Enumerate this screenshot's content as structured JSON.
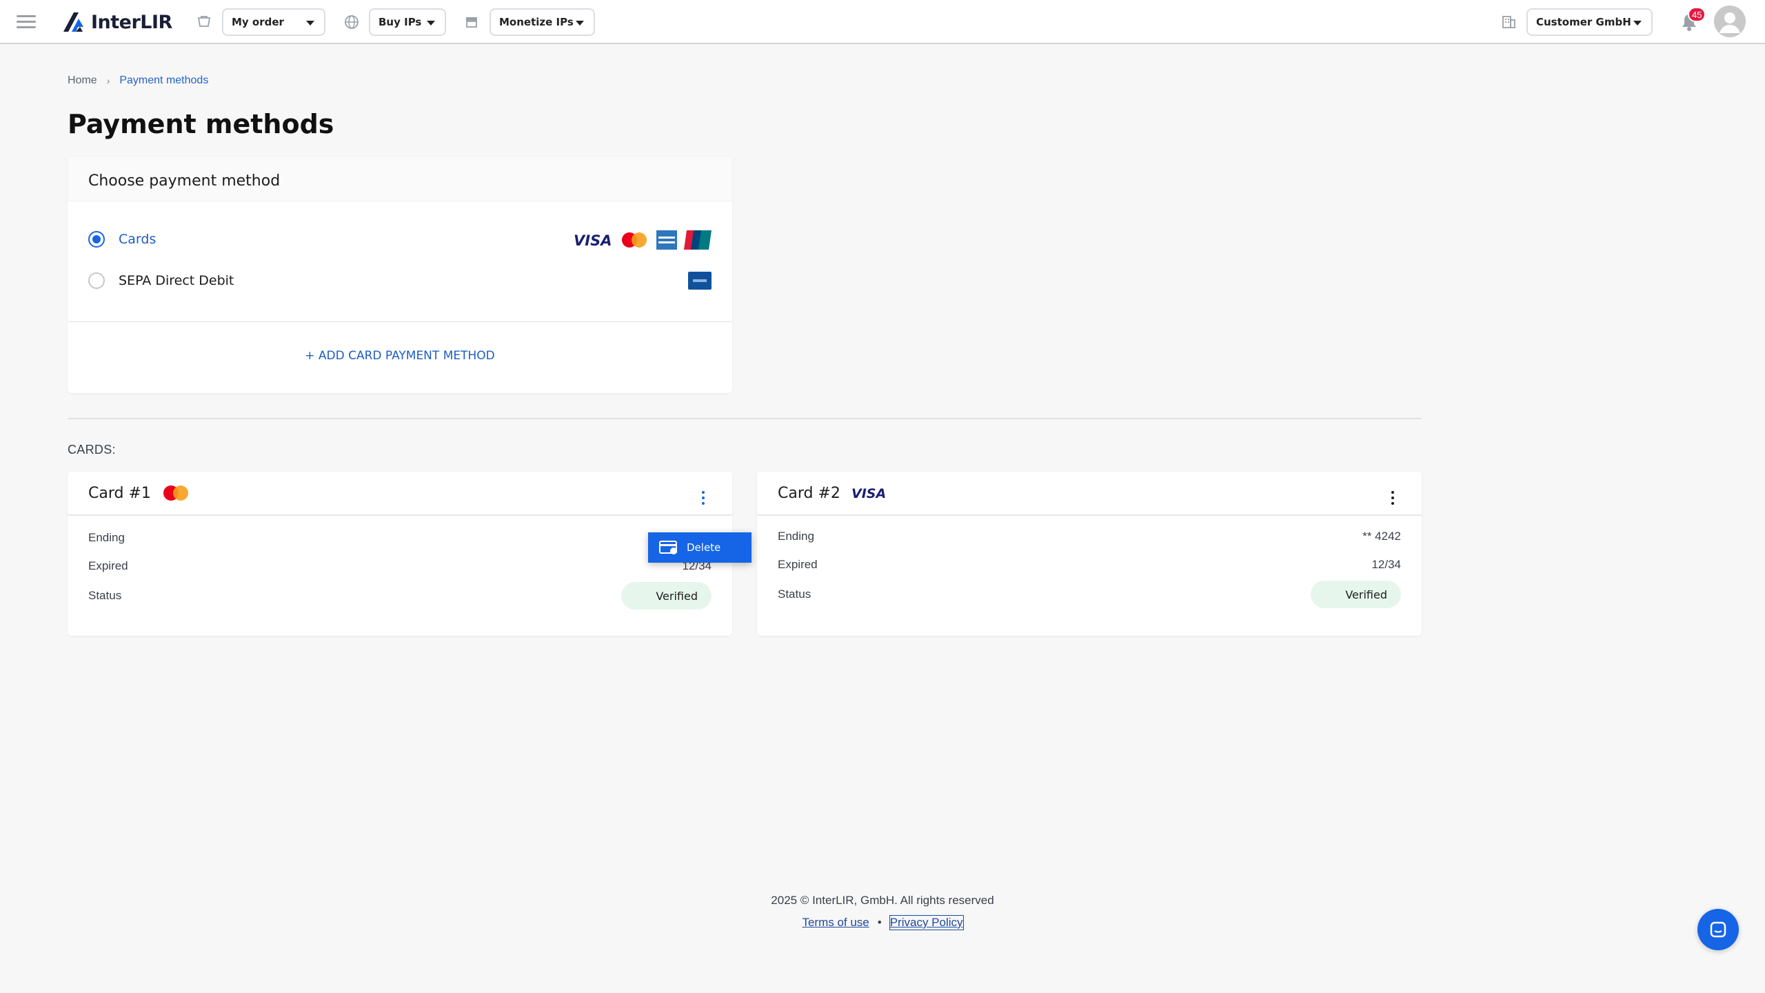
{
  "colors": {
    "accent": "#1565e6",
    "link": "#1e5cc4",
    "badge": "#e5193f",
    "verified_bg": "#e6f6ec"
  },
  "header": {
    "logo_text": "InterLIR",
    "my_order": "My order",
    "buy_ips": "Buy IPs",
    "monetize_ips": "Monetize IPs",
    "company": "Customer GmbH",
    "notification_count": "45"
  },
  "breadcrumb": {
    "home": "Home",
    "current": "Payment methods"
  },
  "page_title": "Payment methods",
  "payment": {
    "heading": "Choose payment method",
    "options": [
      {
        "label": "Cards",
        "selected": true,
        "brands": [
          "visa-icon",
          "mastercard-icon",
          "amex-icon",
          "unionpay-icon"
        ]
      },
      {
        "label": "SEPA Direct Debit",
        "selected": false,
        "brands": [
          "sepa-icon"
        ]
      }
    ],
    "add_button": "+ ADD CARD PAYMENT METHOD"
  },
  "cards_label": "CARDS:",
  "cards": [
    {
      "title": "Card #1",
      "brand": "mastercard-icon",
      "ending_label": "Ending",
      "expired_label": "Expired",
      "expired_value": "12/34",
      "status_label": "Status",
      "status": "Verified"
    },
    {
      "title": "Card #2",
      "brand": "visa-icon",
      "brand_text": "VISA",
      "ending_label": "Ending",
      "ending_value": "** 4242",
      "expired_label": "Expired",
      "expired_value": "12/34",
      "status_label": "Status",
      "status": "Verified"
    }
  ],
  "context_menu": {
    "delete": "Delete"
  },
  "footer": {
    "copyright": "2025 © InterLIR, GmbH. All rights reserved",
    "terms": "Terms of use",
    "bullet": "•",
    "privacy": "Privacy Policy"
  }
}
